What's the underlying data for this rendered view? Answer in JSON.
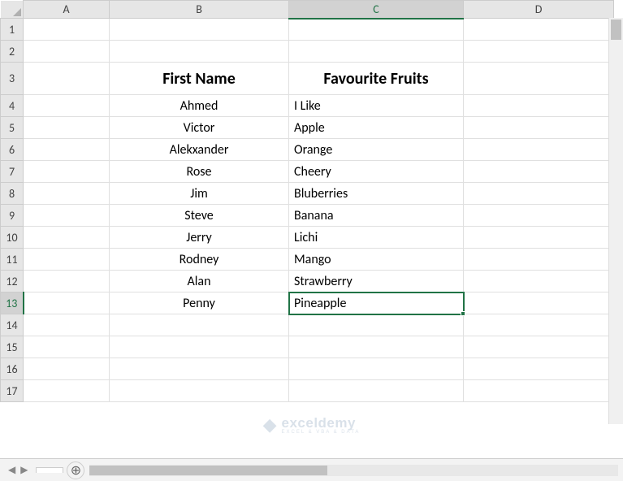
{
  "columns": [
    "A",
    "B",
    "C",
    "D"
  ],
  "rows": [
    "1",
    "2",
    "3",
    "4",
    "5",
    "6",
    "7",
    "8",
    "9",
    "10",
    "11",
    "12",
    "13",
    "14",
    "15",
    "16",
    "17"
  ],
  "active_cell": "C13",
  "header": {
    "b": "First Name",
    "c": "Favourite Fruits"
  },
  "data": [
    {
      "b": "Ahmed",
      "c": "I Like"
    },
    {
      "b": "Victor",
      "c": "Apple"
    },
    {
      "b": "Alekxander",
      "c": "Orange"
    },
    {
      "b": "Rose",
      "c": "Cheery"
    },
    {
      "b": "Jim",
      "c": "Bluberries"
    },
    {
      "b": "Steve",
      "c": "Banana"
    },
    {
      "b": "Jerry",
      "c": "Lichi"
    },
    {
      "b": "Rodney",
      "c": "Mango"
    },
    {
      "b": "Alan",
      "c": "Strawberry"
    },
    {
      "b": "Penny",
      "c": "Pineapple"
    }
  ],
  "watermark": {
    "brand": "exceldemy",
    "sub": "EXCEL & VBA & DATA"
  }
}
